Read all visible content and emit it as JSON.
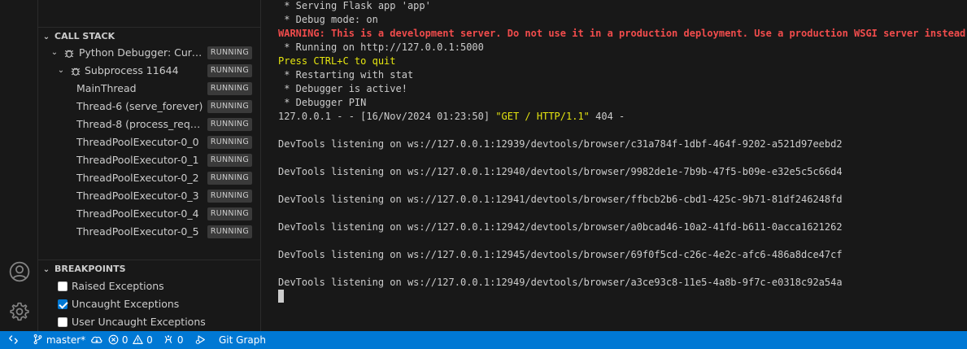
{
  "call_stack": {
    "title": "CALL STACK",
    "sessions": [
      {
        "label": "Python Debugger: Curre...",
        "status": "RUNNING"
      },
      {
        "label": "Subprocess 11644",
        "status": "RUNNING"
      }
    ],
    "threads": [
      {
        "label": "MainThread",
        "status": "RUNNING"
      },
      {
        "label": "Thread-6 (serve_forever)",
        "status": "RUNNING"
      },
      {
        "label": "Thread-8 (process_reque...",
        "status": "RUNNING"
      },
      {
        "label": "ThreadPoolExecutor-0_0",
        "status": "RUNNING"
      },
      {
        "label": "ThreadPoolExecutor-0_1",
        "status": "RUNNING"
      },
      {
        "label": "ThreadPoolExecutor-0_2",
        "status": "RUNNING"
      },
      {
        "label": "ThreadPoolExecutor-0_3",
        "status": "RUNNING"
      },
      {
        "label": "ThreadPoolExecutor-0_4",
        "status": "RUNNING"
      },
      {
        "label": "ThreadPoolExecutor-0_5",
        "status": "RUNNING"
      }
    ]
  },
  "breakpoints": {
    "title": "BREAKPOINTS",
    "items": [
      {
        "label": "Raised Exceptions",
        "checked": false
      },
      {
        "label": "Uncaught Exceptions",
        "checked": true
      },
      {
        "label": "User Uncaught Exceptions",
        "checked": false
      }
    ]
  },
  "terminal": {
    "lines": [
      " * Serving Flask app 'app'",
      " * Debug mode: on",
      "WARNING: This is a development server. Do not use it in a production deployment. Use a production WSGI server instead.",
      " * Running on http://127.0.0.1:5000",
      "Press CTRL+C to quit",
      " * Restarting with stat",
      " * Debugger is active!",
      " * Debugger PIN",
      "127.0.0.1 - - [16/Nov/2024 01:23:50] ",
      "\"GET / HTTP/1.1\"",
      " 404 -",
      "DevTools listening on ws://127.0.0.1:12939/devtools/browser/c31a784f-1dbf-464f-9202-a521d97eebd2",
      "DevTools listening on ws://127.0.0.1:12940/devtools/browser/9982de1e-7b9b-47f5-b09e-e32e5c5c66d4",
      "DevTools listening on ws://127.0.0.1:12941/devtools/browser/ffbcb2b6-cbd1-425c-9b71-81df246248fd",
      "DevTools listening on ws://127.0.0.1:12942/devtools/browser/a0bcad46-10a2-41fd-b611-0acca1621262",
      "DevTools listening on ws://127.0.0.1:12945/devtools/browser/69f0f5cd-c26c-4e2c-afc6-486a8dce47cf",
      "DevTools listening on ws://127.0.0.1:12949/devtools/browser/a3ce93c8-11e5-4a8b-9f7c-e0318c92a54a"
    ]
  },
  "status_bar": {
    "branch": "master*",
    "errors": "0",
    "warnings": "0",
    "ports": "0",
    "git_graph": "Git Graph"
  },
  "colors": {
    "status_bar_bg": "#0078d4",
    "warning_text": "#f14c4c",
    "highlight_text": "#e5e510"
  },
  "icons": [
    "remote-icon",
    "branch-icon",
    "sync-icon",
    "error-icon",
    "warning-icon",
    "ports-icon",
    "debug-run-icon",
    "account-icon",
    "settings-gear-icon",
    "bug-icon"
  ]
}
